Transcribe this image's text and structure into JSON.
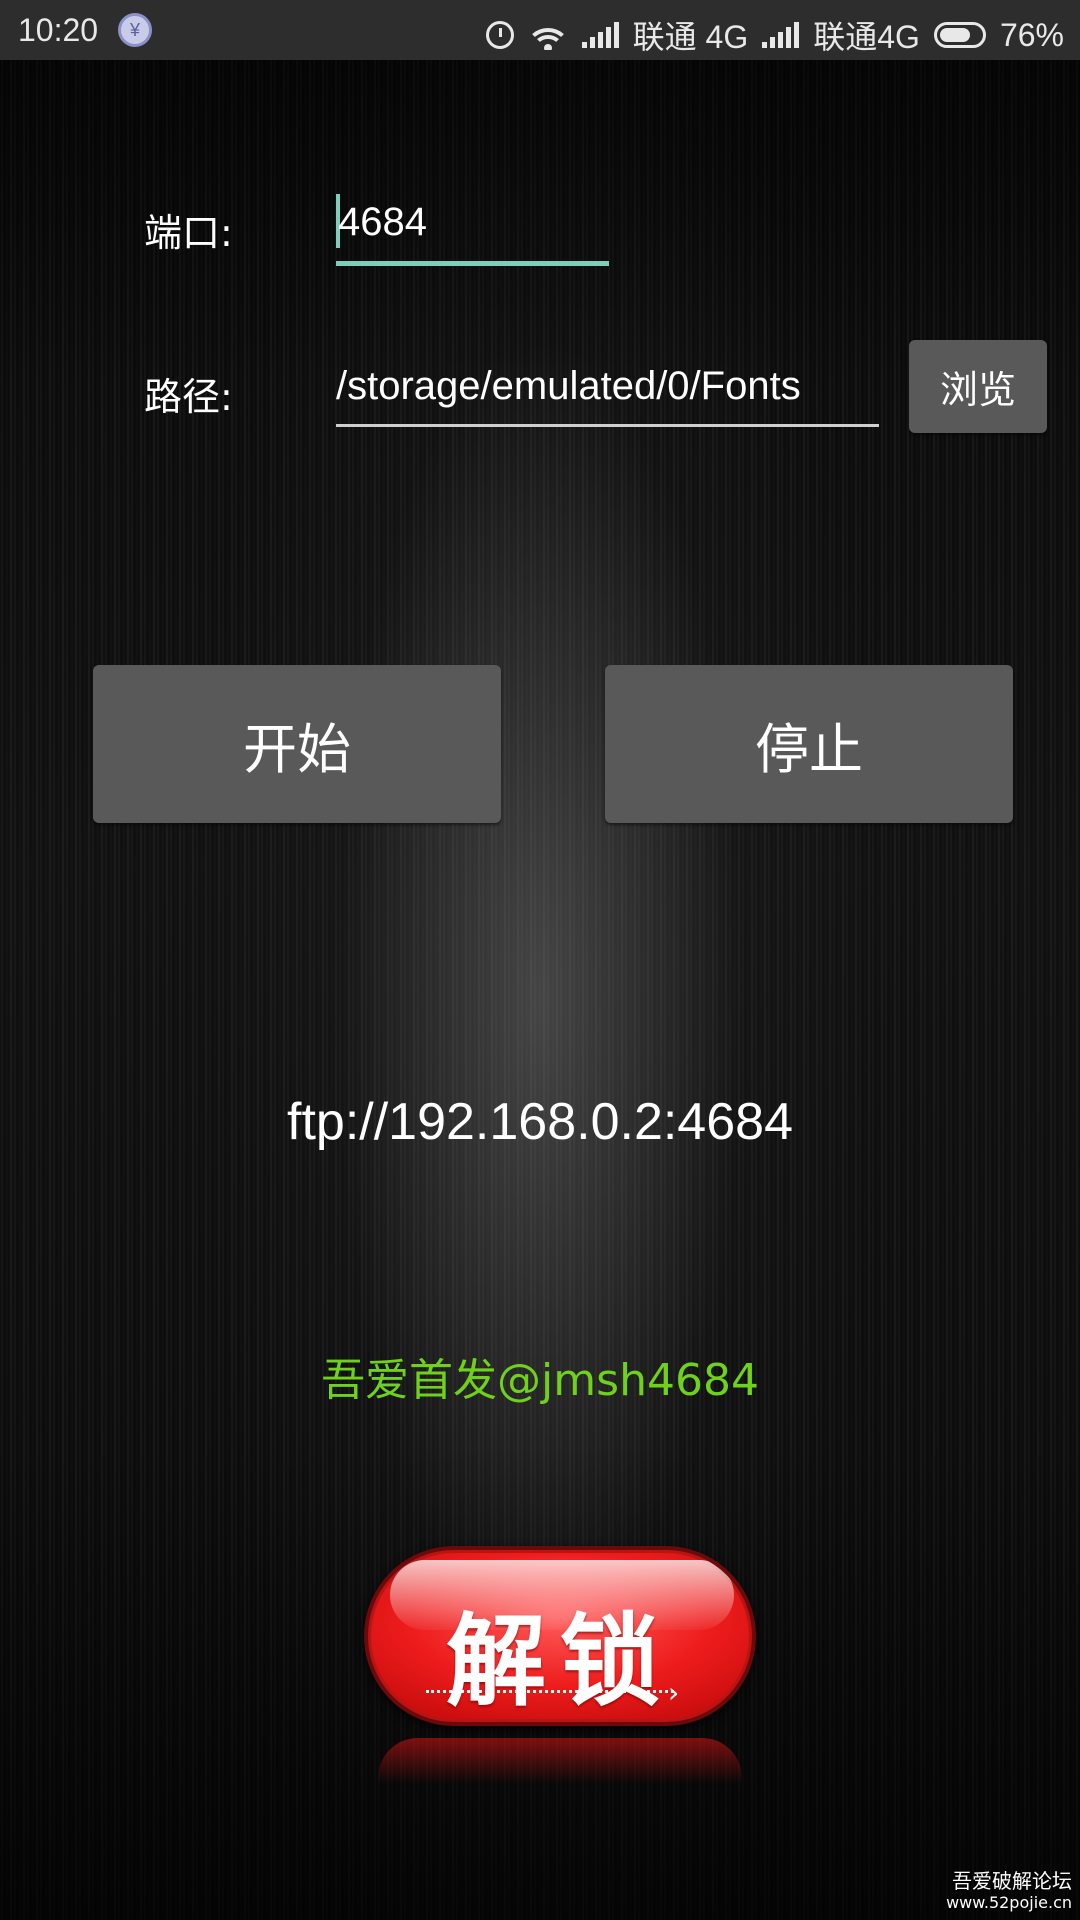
{
  "status_bar": {
    "time": "10:20",
    "app_icon": "yen-icon",
    "carrier1": "联通 4G",
    "carrier2": "联通4G",
    "battery": "76%",
    "battery_level": 0.76
  },
  "form": {
    "port_label": "端口:",
    "port_value": "4684",
    "path_label": "路径:",
    "path_value": "/storage/emulated/0/Fonts",
    "browse_label": "浏览"
  },
  "buttons": {
    "start_label": "开始",
    "stop_label": "停止"
  },
  "ftp_address": "ftp://192.168.0.2:4684",
  "credit": "吾爱首发@jmsh4684",
  "unlock_label": "解锁",
  "watermark": {
    "line1": "吾爱破解论坛",
    "line2": "www.52pojie.cn"
  },
  "colors": {
    "accent": "#7fcdbb",
    "credit": "#6fd11a",
    "button_bg": "#595959",
    "unlock_red": "#ee1c1c"
  }
}
